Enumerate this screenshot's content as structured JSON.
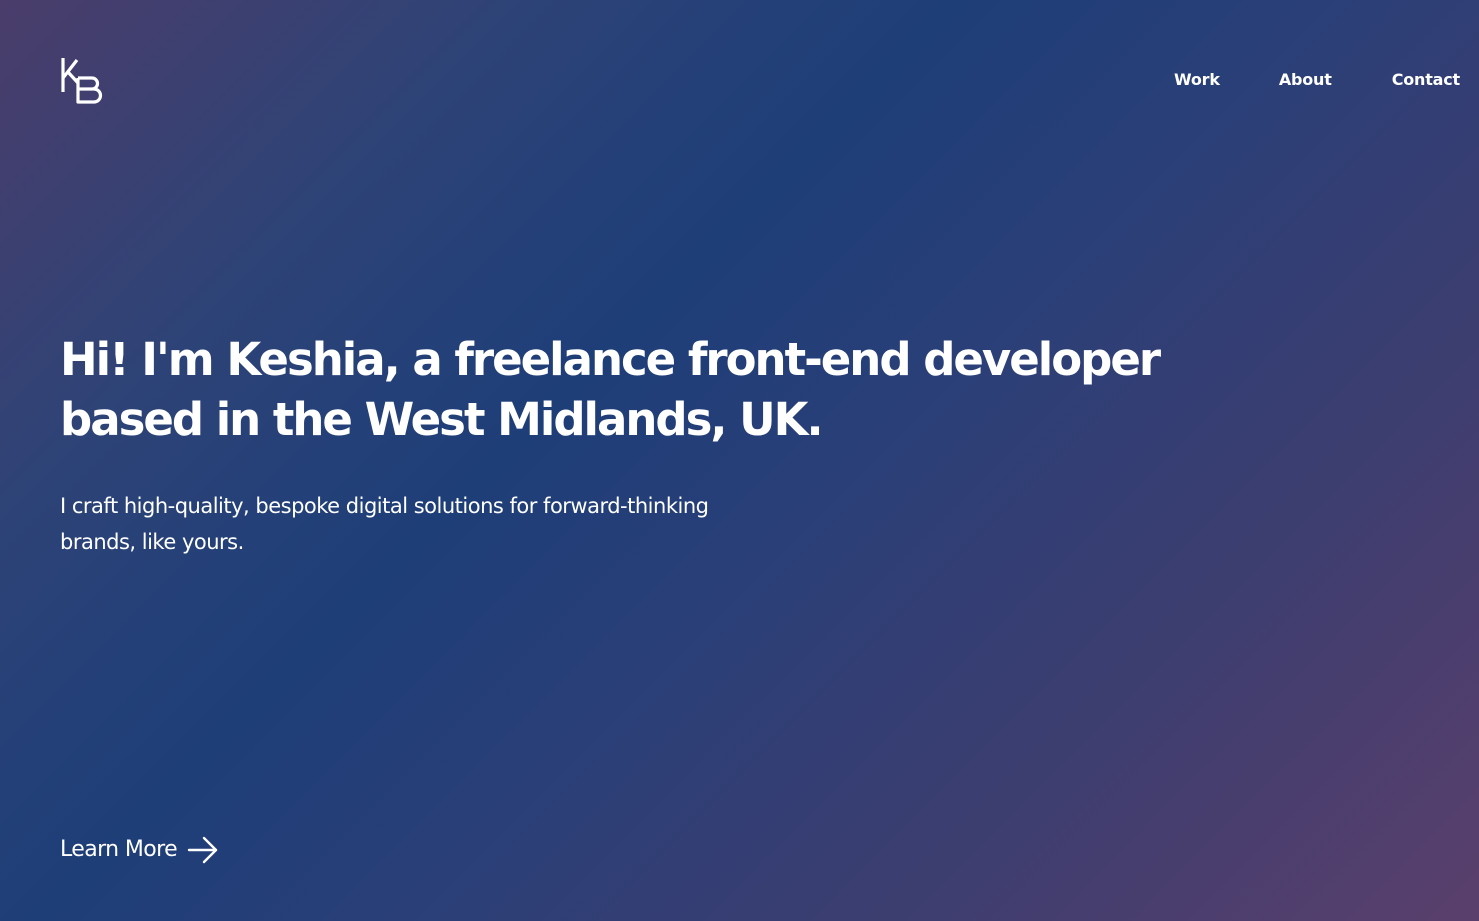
{
  "header": {
    "logo": {
      "icon": "kb-monogram-logo",
      "text": "KB"
    },
    "nav": [
      {
        "label": "Work"
      },
      {
        "label": "About"
      },
      {
        "label": "Contact"
      }
    ]
  },
  "hero": {
    "title": "Hi! I'm Keshia, a freelance front-end developer based in the West Midlands, UK.",
    "subtitle": "I craft high-quality, bespoke digital solutions for forward-thinking brands, like yours."
  },
  "cta": {
    "label": "Learn More",
    "icon": "arrow-right-icon"
  },
  "colors": {
    "text": "#ffffff",
    "gradient_start": "#4a3d6b",
    "gradient_mid": "#1e3e78",
    "gradient_end": "#5a3f6c"
  }
}
